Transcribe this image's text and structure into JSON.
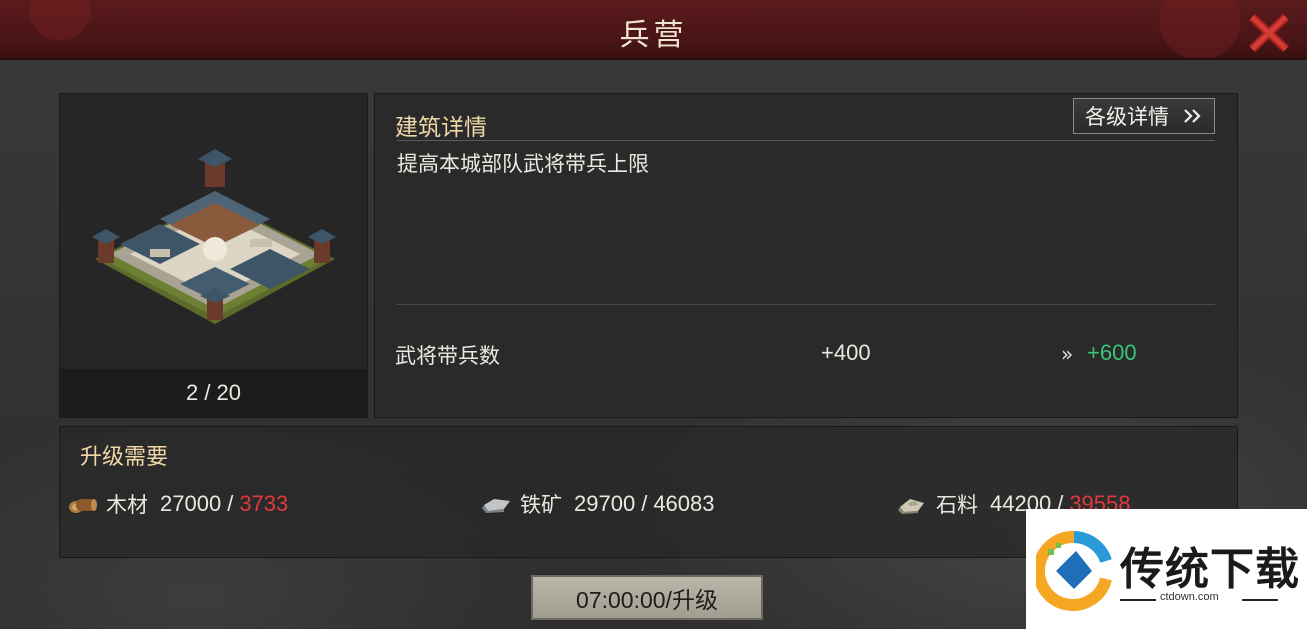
{
  "header": {
    "title": "兵营",
    "close_icon": "close-icon"
  },
  "building": {
    "level": "2 / 20",
    "image_icon": "barracks-image"
  },
  "detail": {
    "heading": "建筑详情",
    "levels_button": "各级详情",
    "levels_button_icon": "double-chevron-right-icon",
    "description": "提高本城部队武将带兵上限",
    "stat": {
      "label": "武将带兵数",
      "current": "+400",
      "arrow": "»",
      "next": "+600"
    }
  },
  "requirements": {
    "heading": "升级需要",
    "resources": [
      {
        "name": "木材",
        "have": "27000",
        "sep": "/",
        "need": "3733",
        "need_color": "red",
        "icon": "wood-icon"
      },
      {
        "name": "铁矿",
        "have": "29700",
        "sep": "/",
        "need": "46083",
        "need_color": "white",
        "icon": "iron-icon"
      },
      {
        "name": "石料",
        "have": "44200",
        "sep": "/",
        "need": "39558",
        "need_color": "red",
        "icon": "stone-icon"
      }
    ]
  },
  "upgrade_button": "07:00:00/升级",
  "watermark": {
    "text": "传统下载",
    "sub": "ctdown.com"
  },
  "colors": {
    "green": "#36c777",
    "red": "#e1393c",
    "gold": "#f0d7a8"
  }
}
